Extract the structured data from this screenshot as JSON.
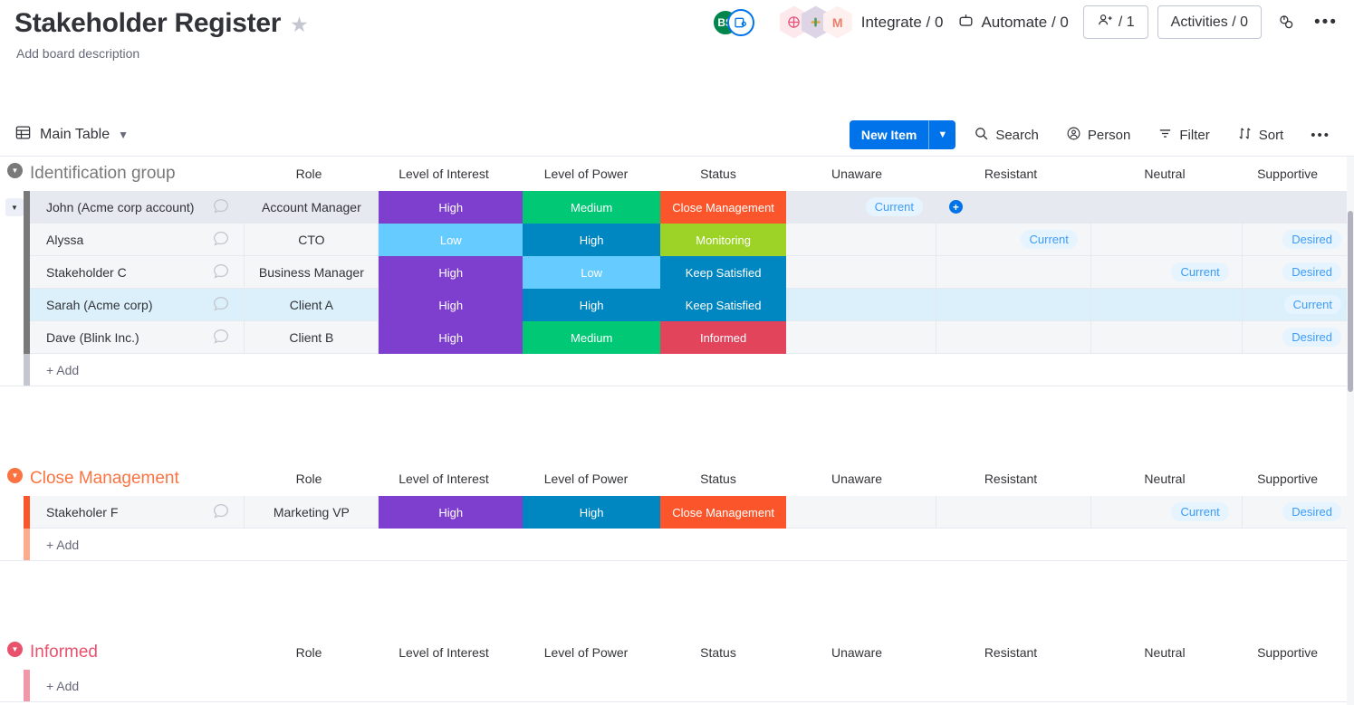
{
  "header": {
    "title": "Stakeholder Register",
    "star_icon": "star-icon",
    "description": "Add board description",
    "avatar_initials": "BS",
    "integrate_label": "Integrate / 0",
    "automate_label": "Automate / 0",
    "invite_label": "/ 1",
    "activities_label": "Activities / 0"
  },
  "view_bar": {
    "view_label": "Main Table",
    "new_item_label": "New Item",
    "search_label": "Search",
    "person_label": "Person",
    "filter_label": "Filter",
    "sort_label": "Sort"
  },
  "columns": {
    "role": "Role",
    "interest": "Level of Interest",
    "power": "Level of Power",
    "status": "Status",
    "unaware": "Unaware",
    "resistant": "Resistant",
    "neutral": "Neutral",
    "supportive": "Supportive"
  },
  "add_label": "+ Add",
  "palette": {
    "purple": "#7e3ece",
    "light_blue": "#66ccff",
    "green": "#00c875",
    "dark_blue": "#0086c0",
    "orange": "#fb562b",
    "lime": "#9cd326",
    "red": "#e2445c",
    "gray_group": "#797979",
    "pill_bg": "#e5f4ff",
    "pill_text": "#3f9bf5",
    "accent_blue": "#0073ea"
  },
  "groups": [
    {
      "name": "Identification group",
      "color": "#797979",
      "collapsed": false,
      "rows": [
        {
          "name": "John (Acme corp account)",
          "role": "Account Manager",
          "interest": "High",
          "interest_color": "#7e3ece",
          "power": "Medium",
          "power_color": "#00c875",
          "status": "Close Management",
          "status_color": "#fb562b",
          "unaware": "Current",
          "resistant": "",
          "neutral": "",
          "supportive": "",
          "resistant_plus": true,
          "selected": false,
          "highlight": true,
          "bar_color": "#797979"
        },
        {
          "name": "Alyssa",
          "role": "CTO",
          "interest": "Low",
          "interest_color": "#66ccff",
          "power": "High",
          "power_color": "#0086c0",
          "status": "Monitoring",
          "status_color": "#9cd326",
          "unaware": "",
          "resistant": "Current",
          "neutral": "",
          "supportive": "Desired",
          "resistant_plus": false,
          "selected": false,
          "highlight": false,
          "bar_color": "#797979"
        },
        {
          "name": "Stakeholder C",
          "role": "Business Manager",
          "interest": "High",
          "interest_color": "#7e3ece",
          "power": "Low",
          "power_color": "#66ccff",
          "status": "Keep Satisfied",
          "status_color": "#0086c0",
          "unaware": "",
          "resistant": "",
          "neutral": "Current",
          "supportive": "Desired",
          "resistant_plus": false,
          "selected": false,
          "highlight": false,
          "bar_color": "#797979"
        },
        {
          "name": "Sarah (Acme corp)",
          "role": "Client A",
          "interest": "High",
          "interest_color": "#7e3ece",
          "power": "High",
          "power_color": "#0086c0",
          "status": "Keep Satisfied",
          "status_color": "#0086c0",
          "unaware": "",
          "resistant": "",
          "neutral": "",
          "supportive": "Current",
          "resistant_plus": false,
          "selected": true,
          "highlight": false,
          "bar_color": "#797979"
        },
        {
          "name": "Dave (Blink Inc.)",
          "role": "Client B",
          "interest": "High",
          "interest_color": "#7e3ece",
          "power": "Medium",
          "power_color": "#00c875",
          "status": "Informed",
          "status_color": "#e2445c",
          "unaware": "",
          "resistant": "",
          "neutral": "",
          "supportive": "Desired",
          "resistant_plus": false,
          "selected": false,
          "highlight": false,
          "bar_color": "#797979"
        }
      ]
    },
    {
      "name": "Close Management",
      "color": "#fb7341",
      "collapsed": false,
      "rows": [
        {
          "name": "Stakeholer F",
          "role": "Marketing VP",
          "interest": "High",
          "interest_color": "#7e3ece",
          "power": "High",
          "power_color": "#0086c0",
          "status": "Close Management",
          "status_color": "#fb562b",
          "unaware": "",
          "resistant": "",
          "neutral": "Current",
          "supportive": "Desired",
          "resistant_plus": false,
          "selected": false,
          "highlight": false,
          "bar_color": "#fb562b"
        }
      ]
    },
    {
      "name": "Informed",
      "color": "#e8526c",
      "collapsed": false,
      "rows": []
    }
  ]
}
